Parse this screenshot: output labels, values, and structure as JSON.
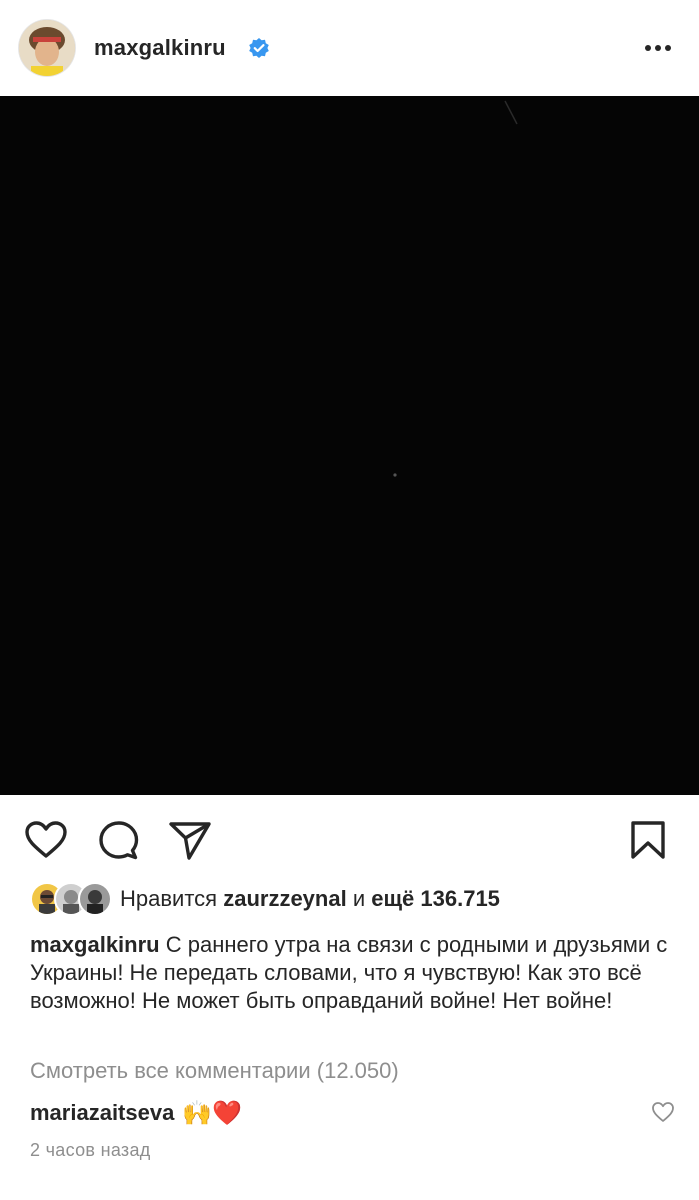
{
  "header": {
    "username": "maxgalkinru",
    "verified_icon": "verified-badge-icon",
    "more_icon": "more-horizontal-icon"
  },
  "post": {
    "image_icon": "post-photo"
  },
  "actions": {
    "like_icon": "heart-icon",
    "comment_icon": "comment-icon",
    "share_icon": "send-icon",
    "save_icon": "bookmark-icon"
  },
  "likes": {
    "prefix": "Нравится",
    "user": "zaurzzeynal",
    "connector": "и",
    "others": "ещё 136.715"
  },
  "caption": {
    "username": "maxgalkinru",
    "text": "С раннего утра на связи с родными и друзьями с Украины! Не передать словами, что я чувствую! Как это всё возможно! Не может быть оправданий войне! Нет войне!"
  },
  "comments": {
    "view_all": "Смотреть все комментарии (12.050)",
    "items": [
      {
        "username": "mariazaitseva",
        "text": "🙌❤️"
      }
    ]
  },
  "timestamp": "2 часов назад",
  "colors": {
    "text": "#262626",
    "secondary": "#8e8e8e",
    "verified": "#3897f0",
    "image_bg": "#050505"
  }
}
